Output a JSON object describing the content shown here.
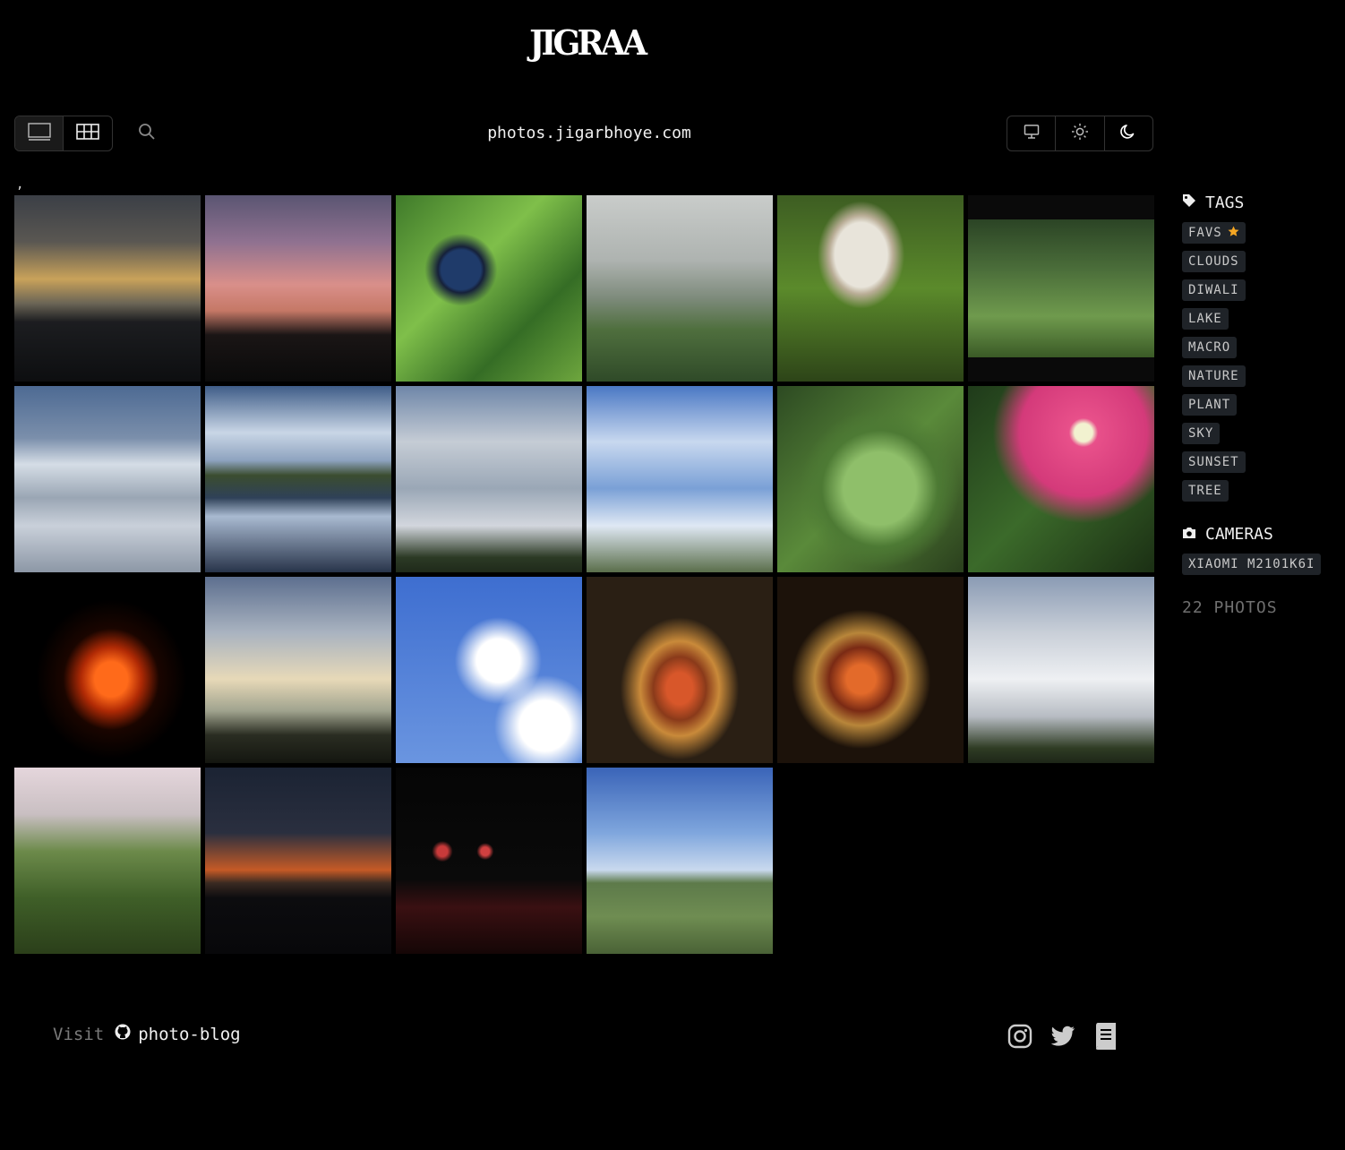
{
  "site": {
    "logo_text": "JIGRAA",
    "domain": "photos.jigarbhoye.com",
    "stray_text": ","
  },
  "toolbar": {
    "views": [
      {
        "name": "full-view",
        "icon": "monitor-outline-icon",
        "active": true
      },
      {
        "name": "grid-view",
        "icon": "grid-icon",
        "active": false
      }
    ],
    "search_icon": "search-icon",
    "themes": [
      {
        "name": "system",
        "icon": "desktop-icon"
      },
      {
        "name": "light",
        "icon": "sun-icon"
      },
      {
        "name": "dark",
        "icon": "moon-icon"
      }
    ]
  },
  "photos": [
    {
      "subject": "sunset clouds over city"
    },
    {
      "subject": "pink sunset sky"
    },
    {
      "subject": "blue butterfly on leaves"
    },
    {
      "subject": "misty hill"
    },
    {
      "subject": "white mushroom"
    },
    {
      "subject": "tractor in field"
    },
    {
      "subject": "snowy mountains"
    },
    {
      "subject": "lake with clouds"
    },
    {
      "subject": "cloudy sky with birds"
    },
    {
      "subject": "bare tree branches"
    },
    {
      "subject": "leaf with water drops"
    },
    {
      "subject": "pink periwinkle flower"
    },
    {
      "subject": "bonfire at night"
    },
    {
      "subject": "sky with crane building"
    },
    {
      "subject": "white clouds blue sky"
    },
    {
      "subject": "diwali rangoli sparklers"
    },
    {
      "subject": "diwali rangoli sparklers 2"
    },
    {
      "subject": "cumulus cloud"
    },
    {
      "subject": "papaya tree"
    },
    {
      "subject": "dusk skyline"
    },
    {
      "subject": "night lanterns"
    },
    {
      "subject": "landscape blue sky"
    }
  ],
  "sidebar": {
    "tags_title": "TAGS",
    "tags": [
      "FAVS",
      "CLOUDS",
      "DIWALI",
      "LAKE",
      "MACRO",
      "NATURE",
      "PLANT",
      "SKY",
      "SUNSET",
      "TREE"
    ],
    "cameras_title": "CAMERAS",
    "cameras": [
      "XIAOMI M2101K6I"
    ],
    "photo_count": "22 PHOTOS"
  },
  "footer": {
    "visit_label": "Visit",
    "repo_link": "photo-blog",
    "socials": [
      "instagram-icon",
      "twitter-icon",
      "blog-icon"
    ]
  },
  "colors": {
    "background": "#000000",
    "tag_bg": "#1f2328",
    "favs_star": "#f5a623"
  }
}
